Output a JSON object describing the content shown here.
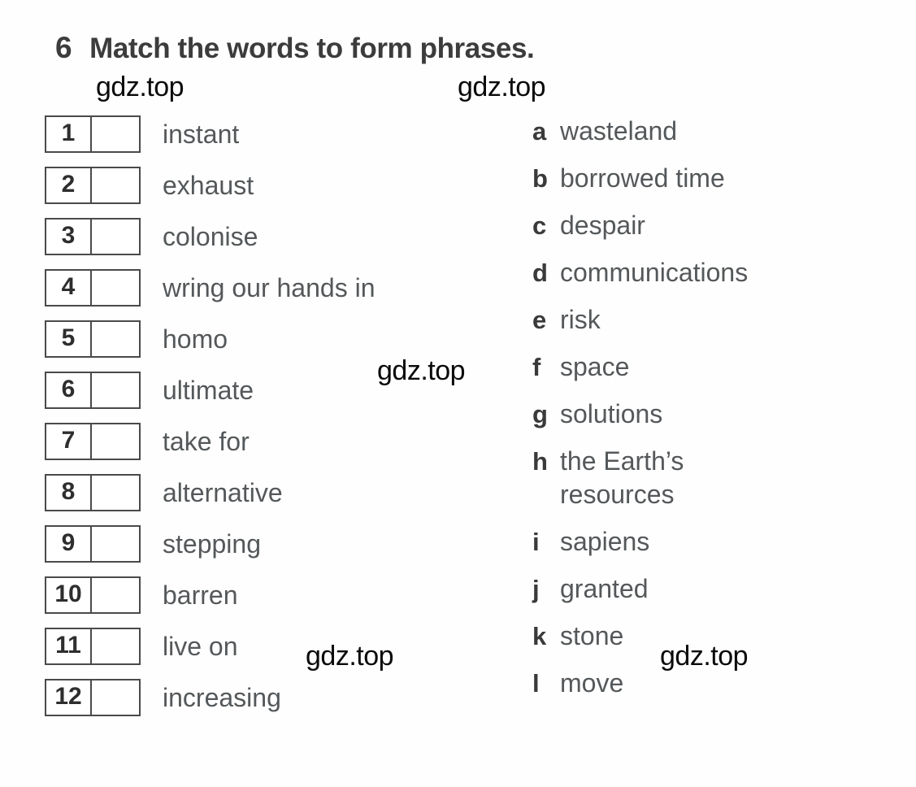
{
  "exercise": {
    "number": "6",
    "instruction": "Match the words to form phrases."
  },
  "left_column": {
    "items": [
      {
        "number": "1",
        "text": "instant",
        "answer": ""
      },
      {
        "number": "2",
        "text": "exhaust",
        "answer": ""
      },
      {
        "number": "3",
        "text": "colonise",
        "answer": ""
      },
      {
        "number": "4",
        "text": "wring our hands in",
        "answer": ""
      },
      {
        "number": "5",
        "text": "homo",
        "answer": ""
      },
      {
        "number": "6",
        "text": "ultimate",
        "answer": ""
      },
      {
        "number": "7",
        "text": "take for",
        "answer": ""
      },
      {
        "number": "8",
        "text": "alternative",
        "answer": ""
      },
      {
        "number": "9",
        "text": "stepping",
        "answer": ""
      },
      {
        "number": "10",
        "text": "barren",
        "answer": ""
      },
      {
        "number": "11",
        "text": "live on",
        "answer": ""
      },
      {
        "number": "12",
        "text": "increasing",
        "answer": ""
      }
    ]
  },
  "right_column": {
    "items": [
      {
        "letter": "a",
        "text": "wasteland"
      },
      {
        "letter": "b",
        "text": "borrowed time"
      },
      {
        "letter": "c",
        "text": "despair"
      },
      {
        "letter": "d",
        "text": "communications"
      },
      {
        "letter": "e",
        "text": "risk"
      },
      {
        "letter": "f",
        "text": "space"
      },
      {
        "letter": "g",
        "text": "solutions"
      },
      {
        "letter": "h",
        "text": "the Earth’s resources"
      },
      {
        "letter": "i",
        "text": "sapiens"
      },
      {
        "letter": "j",
        "text": "granted"
      },
      {
        "letter": "k",
        "text": "stone"
      },
      {
        "letter": "l",
        "text": "move"
      }
    ]
  },
  "watermarks": [
    {
      "text": "gdz.top"
    },
    {
      "text": "gdz.top"
    },
    {
      "text": "gdz.top"
    },
    {
      "text": "gdz.top"
    },
    {
      "text": "gdz.top"
    }
  ],
  "colors": {
    "page_background": "#fefefe",
    "heading_text": "#3c3c3c",
    "body_text": "#55585a",
    "box_border": "#4a4a4a",
    "watermark_text": "#0a0a0a"
  }
}
